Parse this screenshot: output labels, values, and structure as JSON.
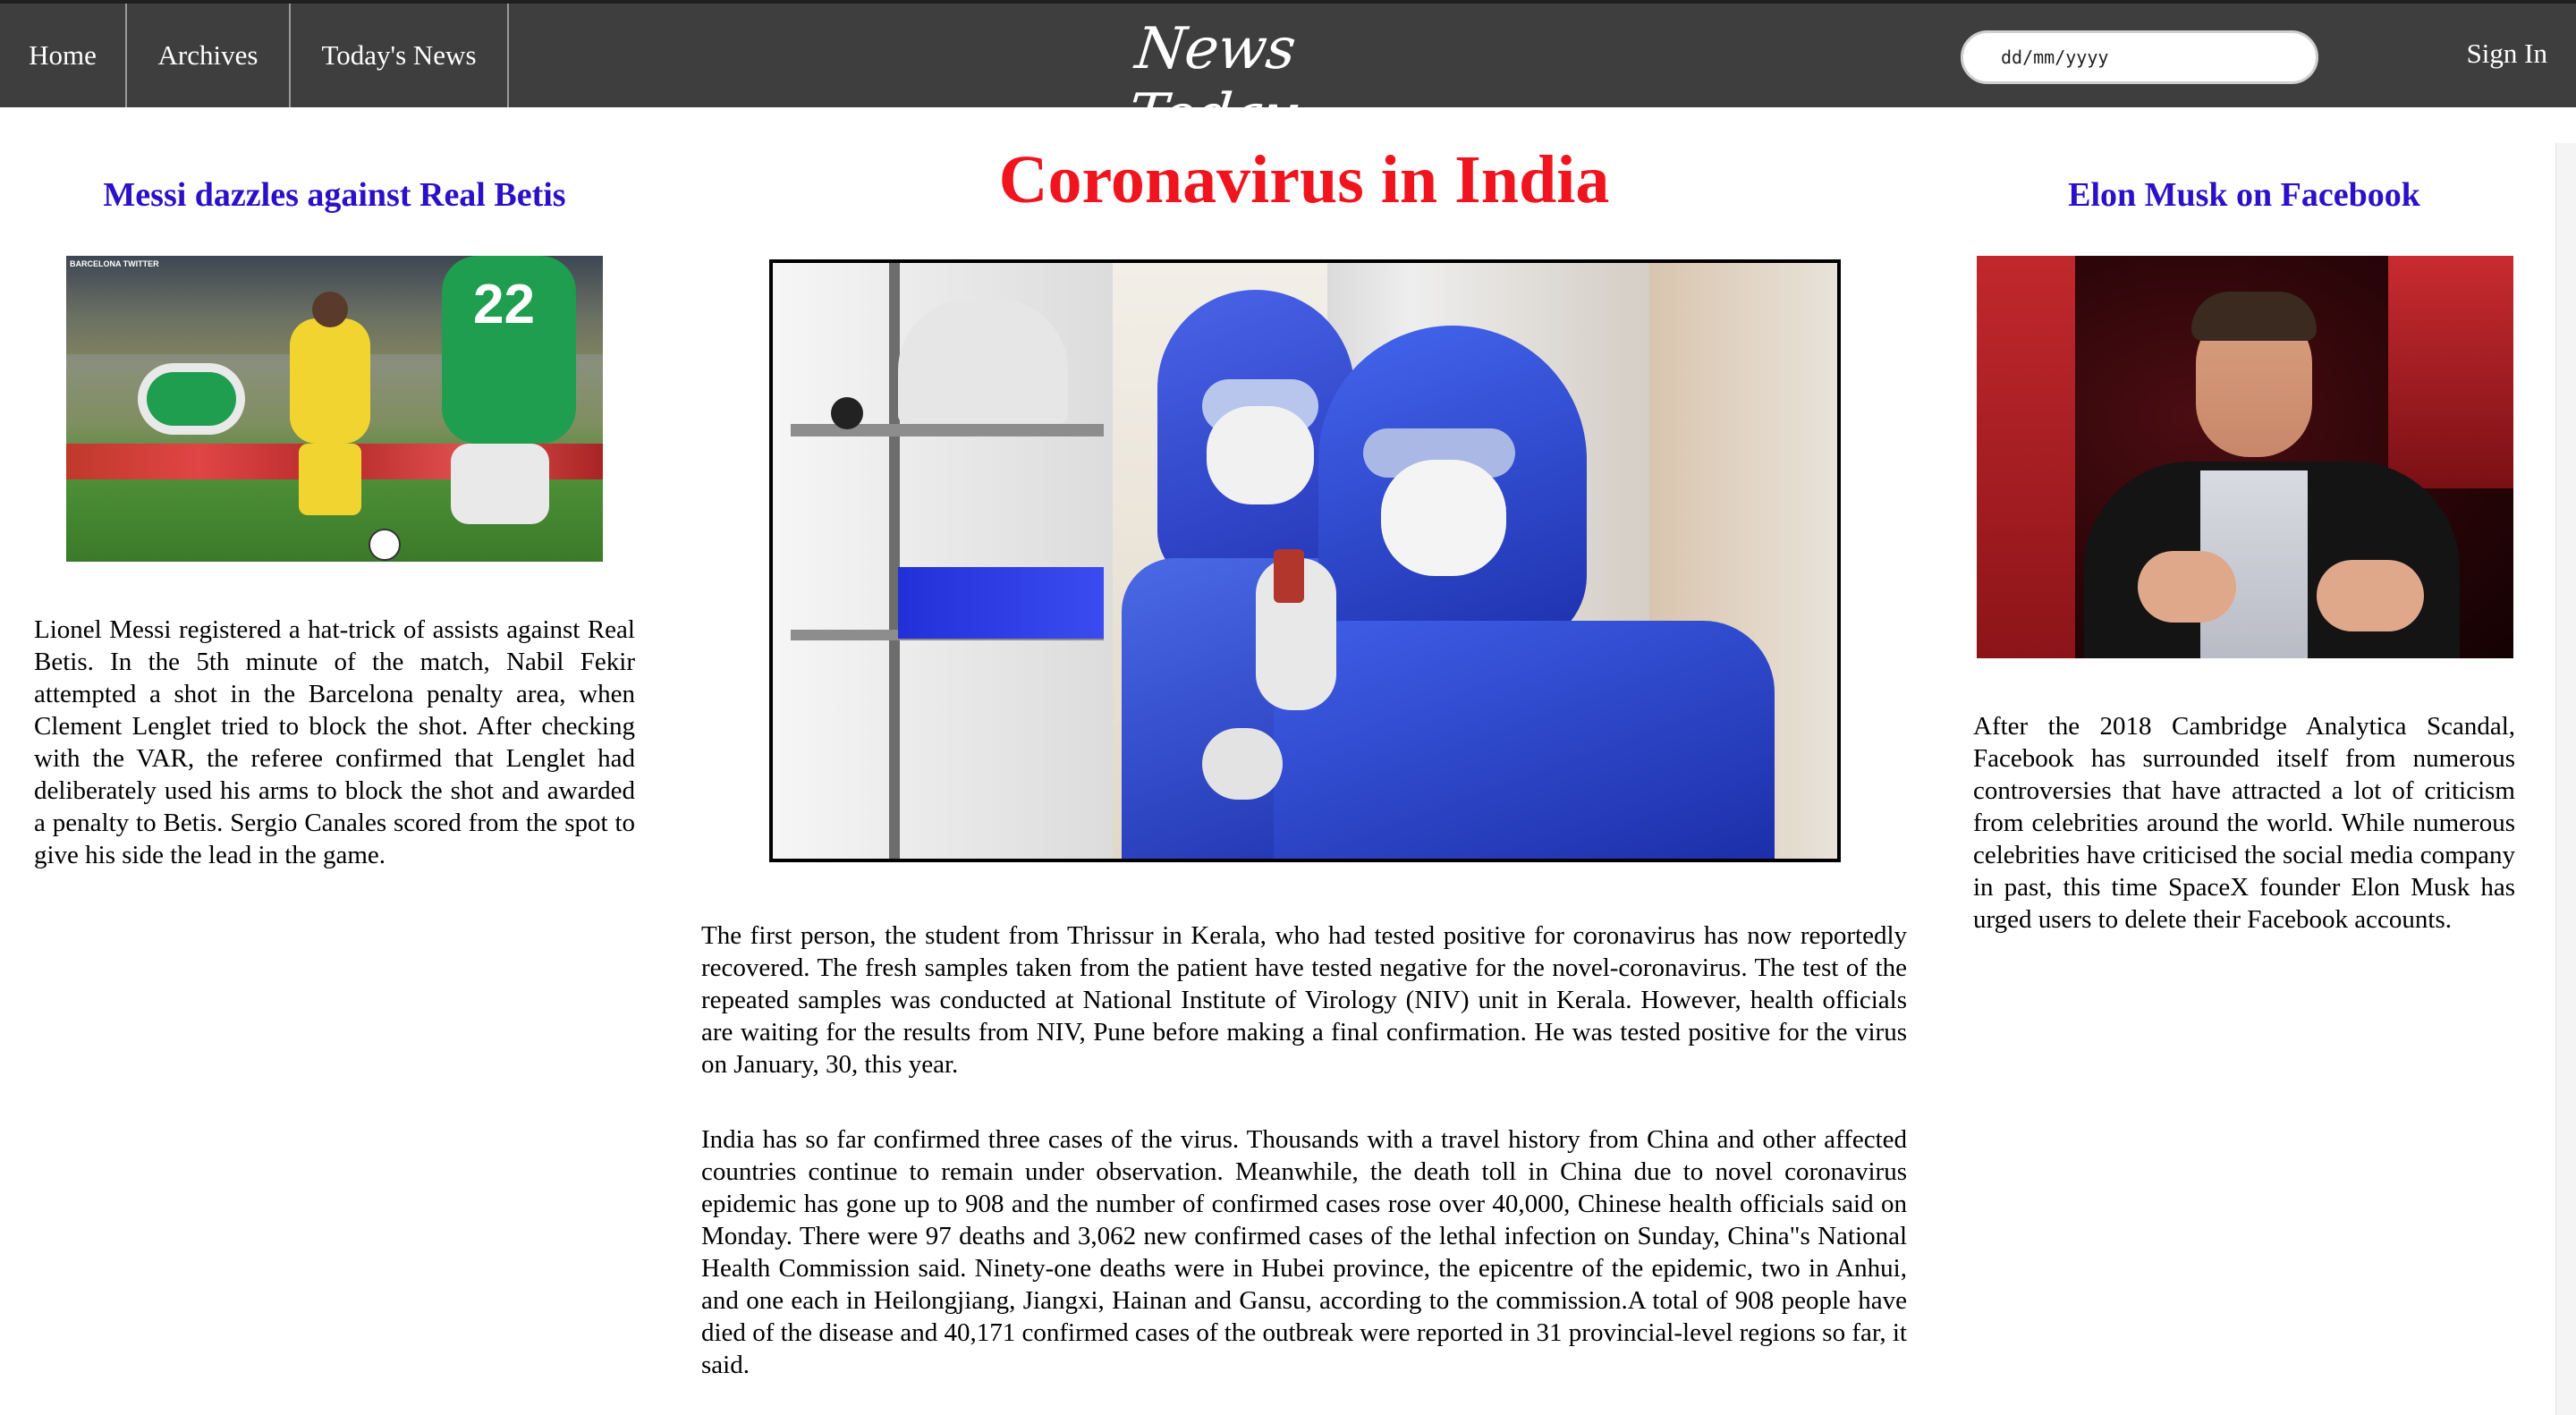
{
  "nav": {
    "links": [
      "Home",
      "Archives",
      "Today's News"
    ],
    "brand": "News Today",
    "date_placeholder": "dd/mm/yyyy",
    "sign_in": "Sign In"
  },
  "left": {
    "title": "Messi dazzles against Real Betis",
    "image_caption": "BARCELONA TWITTER",
    "body": "Lionel Messi registered a hat-trick of assists against Real Betis. In the 5th minute of the match, Nabil Fekir attempted a shot in the Barcelona penalty area, when Clement Lenglet tried to block the shot. After checking with the VAR, the referee confirmed that Lenglet had deliberately used his arms to block the shot and awarded a penalty to Betis. Sergio Canales scored from the spot to give his side the lead in the game."
  },
  "center": {
    "title": "Coronavirus in India",
    "paragraphs": [
      "The first person, the student from Thrissur in Kerala, who had tested positive for coronavirus has now reportedly recovered. The fresh samples taken from the patient have tested negative for the novel-coronavirus. The test of the repeated samples was conducted at National Institute of Virology (NIV) unit in Kerala. However, health officials are waiting for the results from NIV, Pune before making a final confirmation. He was tested positive for the virus on January, 30, this year.",
      "India has so far confirmed three cases of the virus. Thousands with a travel history from China and other affected countries continue to remain under observation. Meanwhile, the death toll in China due to novel coronavirus epidemic has gone up to 908 and the number of confirmed cases rose over 40,000, Chinese health officials said on Monday. There were 97 deaths and 3,062 new confirmed cases of the lethal infection on Sunday, China\"s National Health Commission said. Ninety-one deaths were in Hubei province, the epicentre of the epidemic, two in Anhui, and one each in Heilongjiang, Jiangxi, Hainan and Gansu, according to the commission.A total of 908 people have died of the disease and 40,171 confirmed cases of the outbreak were reported in 31 provincial-level regions so far, it said."
    ]
  },
  "right": {
    "title": "Elon Musk on Facebook",
    "body": "After the 2018 Cambridge Analytica Scandal, Facebook has surrounded itself from numerous controversies that have attracted a lot of criticism from celebrities around the world. While numerous celebrities have criticised the social media company in past, this time SpaceX founder Elon Musk has urged users to delete their Facebook accounts."
  },
  "colors": {
    "nav_bg": "#3e3e3e",
    "side_title": "#2a10c8",
    "main_title": "#f0141e"
  }
}
